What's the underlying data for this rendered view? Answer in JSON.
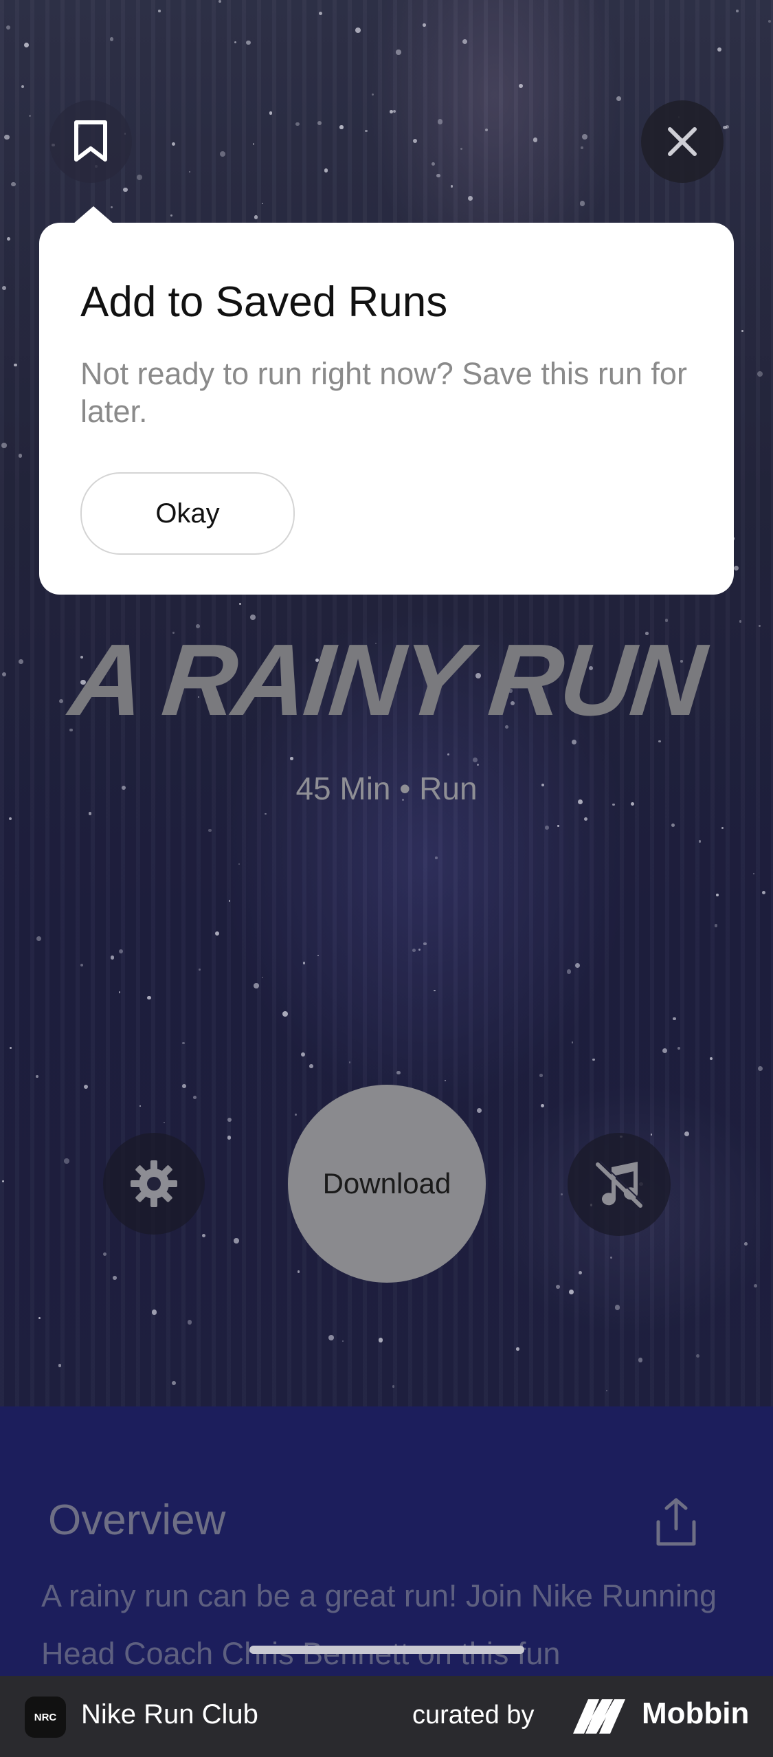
{
  "popover": {
    "title": "Add to Saved Runs",
    "body": "Not ready to run right now? Save this run for later.",
    "okay_label": "Okay"
  },
  "run": {
    "title": "A RAINY RUN",
    "meta": "45 Min • Run"
  },
  "controls": {
    "download_label": "Download"
  },
  "overview": {
    "heading": "Overview",
    "text": "A rainy run can be a great run! Join Nike Running Head Coach Chris Bennett on this fun"
  },
  "footer": {
    "app_icon_text": "NRC",
    "app_name": "Nike Run Club",
    "curated_by": "curated by",
    "brand": "Mobbin"
  },
  "icons": {
    "bookmark": "bookmark-icon",
    "close": "close-icon",
    "settings": "gear-icon",
    "music_off": "music-off-icon",
    "share": "share-icon"
  },
  "colors": {
    "lower_panel": "#1c1e5c",
    "popover": "#ffffff",
    "download_button": "#8a8a8e"
  }
}
